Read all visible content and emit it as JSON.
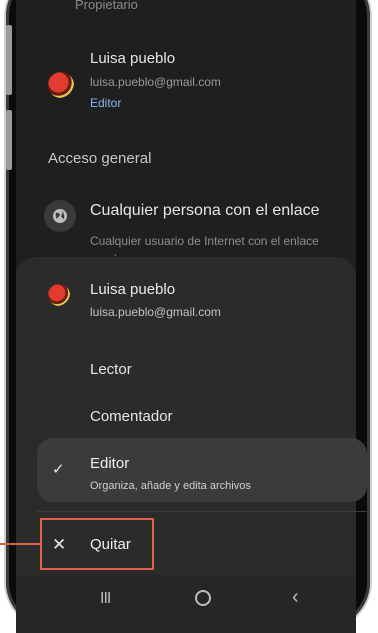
{
  "owner_role": "Propietario",
  "shared_user": {
    "name": "Luisa pueblo",
    "email": "luisa.pueblo@gmail.com",
    "role": "Editor"
  },
  "general_access": {
    "heading": "Acceso general",
    "title": "Cualquier persona con el enlace",
    "description": "Cualquier usuario de Internet con el enlace puede ver"
  },
  "sheet": {
    "name": "Luisa pueblo",
    "email": "luisa.pueblo@gmail.com",
    "options": {
      "lector": "Lector",
      "comentador": "Comentador",
      "editor": "Editor",
      "editor_desc": "Organiza, añade y edita archivos",
      "quitar": "Quitar"
    },
    "selected": "Editor"
  },
  "nav": {
    "recents": "III",
    "home": "",
    "back": "‹"
  },
  "colors": {
    "highlight": "#e0604a",
    "link": "#8ab4f8"
  }
}
